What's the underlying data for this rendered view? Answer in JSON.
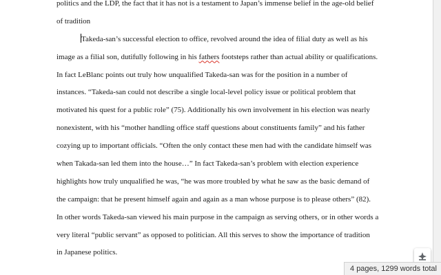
{
  "document": {
    "lines": [
      "politics and the LDP, the fact that it has not is a testament to Japan’s immense belief in the age-old belief",
      "of tradition",
      "Takeda-san’s successful election to office, revolved around the idea of filial duty as well as his",
      "image as a filial son, dutifully following in his ",
      "fathers",
      " footsteps rather than actual ability or qualifications.",
      "In fact LeBlanc points out truly how unqualified Takeda-san was for the position in a number of",
      "instances.  “Takeda-san could not describe a single local-level policy issue or political problem that",
      "motivated his quest for a public role” (75).  Additionally his own involvement in his election was nearly",
      "nonexistent, with his “mother handling office staff questions about constituents family” and his father",
      "cozying up to important officials.  “Often the only contact these men had with the candidate himself was",
      "when Takada-san led them into the house…” In fact Takeda-san’s  problem with election experience",
      "highlights how truly unqualified he was, “he was more troubled by what he saw as the basic demand of",
      "the campaign: that he present himself again and again as a man whose purpose is to please others” (82).",
      "In other words Takeda-san viewed his main purpose in the campaign as serving others, or in other words a",
      "very literal “public servant” as opposed to politician.  All this serves to show the importance of tradition",
      "in Japanese politics."
    ]
  },
  "status_bar": {
    "word_count": "4 pages, 1299 words total"
  },
  "explore": {
    "icon": "explore-sparkle-icon"
  }
}
